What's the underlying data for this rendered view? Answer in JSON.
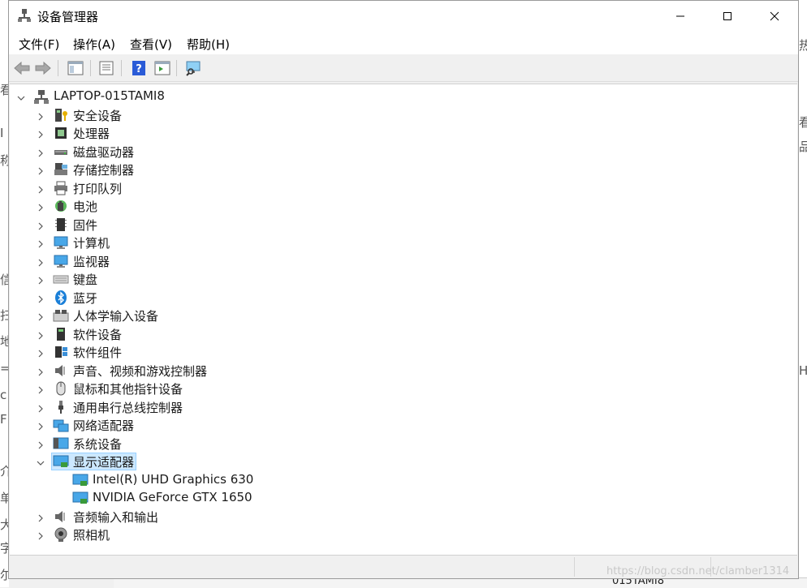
{
  "window": {
    "title": "设备管理器"
  },
  "menu": [
    {
      "label": "文件(F)"
    },
    {
      "label": "操作(A)"
    },
    {
      "label": "查看(V)"
    },
    {
      "label": "帮助(H)"
    }
  ],
  "tree": {
    "root": "LAPTOP-015TAMI8",
    "categories": [
      {
        "label": "安全设备",
        "icon": "security-device-icon"
      },
      {
        "label": "处理器",
        "icon": "processor-icon"
      },
      {
        "label": "磁盘驱动器",
        "icon": "disk-drive-icon"
      },
      {
        "label": "存储控制器",
        "icon": "storage-controller-icon"
      },
      {
        "label": "打印队列",
        "icon": "printer-icon"
      },
      {
        "label": "电池",
        "icon": "battery-icon"
      },
      {
        "label": "固件",
        "icon": "firmware-icon"
      },
      {
        "label": "计算机",
        "icon": "computer-icon"
      },
      {
        "label": "监视器",
        "icon": "monitor-icon"
      },
      {
        "label": "键盘",
        "icon": "keyboard-icon"
      },
      {
        "label": "蓝牙",
        "icon": "bluetooth-icon"
      },
      {
        "label": "人体学输入设备",
        "icon": "hid-icon"
      },
      {
        "label": "软件设备",
        "icon": "software-device-icon"
      },
      {
        "label": "软件组件",
        "icon": "software-component-icon"
      },
      {
        "label": "声音、视频和游戏控制器",
        "icon": "sound-icon"
      },
      {
        "label": "鼠标和其他指针设备",
        "icon": "mouse-icon"
      },
      {
        "label": "通用串行总线控制器",
        "icon": "usb-icon"
      },
      {
        "label": "网络适配器",
        "icon": "network-adapter-icon"
      },
      {
        "label": "系统设备",
        "icon": "system-device-icon"
      },
      {
        "label": "显示适配器",
        "icon": "display-adapter-icon",
        "expanded": true,
        "selected": true,
        "children": [
          {
            "label": "Intel(R) UHD Graphics 630"
          },
          {
            "label": "NVIDIA GeForce GTX 1650"
          }
        ]
      },
      {
        "label": "音频输入和输出",
        "icon": "audio-io-icon"
      },
      {
        "label": "照相机",
        "icon": "camera-icon"
      }
    ]
  },
  "background": {
    "bottom_text": "015TAMI8",
    "left_fragments": [
      "看",
      "I",
      "称",
      "信",
      "扫",
      "地",
      "=",
      "c",
      "F",
      "介",
      "单",
      "大",
      "字",
      "尔"
    ],
    "right_fragments": [
      "热",
      "看",
      "品",
      "H"
    ]
  },
  "watermark": "https://blog.csdn.net/clamber1314",
  "colors": {
    "selection_bg": "#cce8ff",
    "selection_border": "#99d1ff"
  }
}
